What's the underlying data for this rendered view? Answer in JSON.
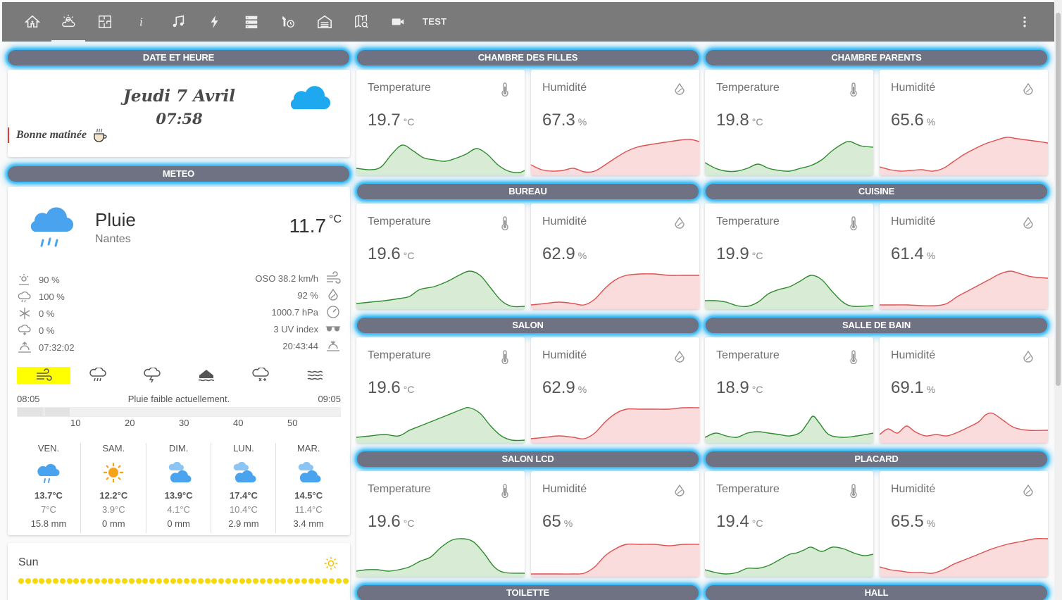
{
  "topbar": {
    "tabs": [
      {
        "icon": "home-icon",
        "active": false
      },
      {
        "icon": "weather-icon",
        "active": true
      },
      {
        "icon": "floorplan-icon",
        "active": false
      },
      {
        "icon": "info-icon",
        "active": false
      },
      {
        "icon": "music-icon",
        "active": false
      },
      {
        "icon": "flash-icon",
        "active": false
      },
      {
        "icon": "server-icon",
        "active": false
      },
      {
        "icon": "tools-clock-icon",
        "active": false
      },
      {
        "icon": "garage-icon",
        "active": false
      },
      {
        "icon": "map-search-icon",
        "active": false
      },
      {
        "icon": "video-icon",
        "active": false
      }
    ],
    "text_tab": "TEST"
  },
  "date_card": {
    "header": "DATE ET HEURE",
    "date": "Jeudi 7 Avril",
    "time": "07:58",
    "greeting": "Bonne matinée"
  },
  "meteo": {
    "header": "METEO",
    "state": "Pluie",
    "city": "Nantes",
    "temperature": "11.7",
    "temperature_unit": "°C",
    "left_attrs": [
      {
        "icon": "humidity-sun-icon",
        "value": "90 %"
      },
      {
        "icon": "cloud-rain-icon",
        "value": "100 %"
      },
      {
        "icon": "snowflake-icon",
        "value": "0 %"
      },
      {
        "icon": "cloud-snow-icon",
        "value": "0 %"
      },
      {
        "icon": "sunrise-icon",
        "value": "07:32:02"
      }
    ],
    "right_attrs": [
      {
        "icon": "wind-icon",
        "value": "OSO 38.2 km/h"
      },
      {
        "icon": "water-percent-icon",
        "value": "92 %"
      },
      {
        "icon": "gauge-icon",
        "value": "1000.7 hPa"
      },
      {
        "icon": "sunglasses-icon",
        "value": "3 UV index"
      },
      {
        "icon": "sunset-icon",
        "value": "20:43:44"
      }
    ],
    "modes": [
      "wind-mode-icon",
      "rain-mode-icon",
      "storm-mode-icon",
      "home-flood-icon",
      "snow-mode-icon",
      "waves-icon"
    ],
    "active_mode": 0,
    "active_color": "#ffff00",
    "rain_start": "08:05",
    "rain_end": "09:05",
    "rain_text": "Pluie faible actuellement.",
    "rain_ticks": [
      "10",
      "20",
      "30",
      "40",
      "50"
    ],
    "rain_progress": 0.16,
    "forecast": [
      {
        "day": "VEN.",
        "icon": "rain-cloud-icon",
        "high": "13.7°C",
        "low": "7°C",
        "rain": "15.8 mm"
      },
      {
        "day": "SAM.",
        "icon": "sun-icon",
        "high": "12.2°C",
        "low": "3.9°C",
        "rain": "0 mm"
      },
      {
        "day": "DIM.",
        "icon": "cloudy-icon",
        "high": "13.9°C",
        "low": "4.1°C",
        "rain": "0 mm"
      },
      {
        "day": "LUN.",
        "icon": "cloudy-icon",
        "high": "17.4°C",
        "low": "10.4°C",
        "rain": "2.9 mm"
      },
      {
        "day": "MAR.",
        "icon": "cloudy-icon",
        "high": "14.5°C",
        "low": "11.4°C",
        "rain": "3.4 mm"
      }
    ]
  },
  "sun": {
    "label": "Sun"
  },
  "rooms": [
    {
      "name": "CHAMBRE DES FILLES",
      "temp": "19.7",
      "hum": "67.3"
    },
    {
      "name": "CHAMBRE PARENTS",
      "temp": "19.8",
      "hum": "65.6"
    },
    {
      "name": "BUREAU",
      "temp": "19.6",
      "hum": "62.9"
    },
    {
      "name": "CUISINE",
      "temp": "19.9",
      "hum": "61.4"
    },
    {
      "name": "SALON",
      "temp": "19.6",
      "hum": "62.9"
    },
    {
      "name": "SALLE DE BAIN",
      "temp": "18.9",
      "hum": "69.1"
    },
    {
      "name": "SALON LCD",
      "temp": "19.6",
      "hum": "65"
    },
    {
      "name": "PLACARD",
      "temp": "19.4",
      "hum": "65.5"
    },
    {
      "name": "TOILETTE",
      "temp": "",
      "hum": ""
    },
    {
      "name": "HALL",
      "temp": "",
      "hum": ""
    }
  ],
  "labels": {
    "temperature": "Temperature",
    "humidity": "Humidité",
    "temp_unit": "°C",
    "hum_unit": "%"
  },
  "colors": {
    "temp_line": "#2e8b2e",
    "temp_fill": "#d8ecd5",
    "hum_line": "#e05050",
    "hum_fill": "#fbdcdc",
    "glow": "#29b6f6",
    "header_bg": "#6e7282"
  }
}
